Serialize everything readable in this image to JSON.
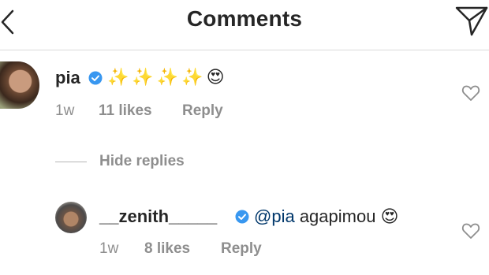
{
  "header": {
    "title": "Comments",
    "back_icon": "chevron-left-icon",
    "send_icon": "paper-plane-icon"
  },
  "comment": {
    "username": "pia",
    "text": "✨✨✨✨😍",
    "time": "1w",
    "likes": "11 likes",
    "reply": "Reply"
  },
  "hide_replies": "Hide replies",
  "reply": {
    "username": "__zenith_____",
    "mention": "@pia",
    "text": " agapimou 😍",
    "time": "1w",
    "likes": "8 likes",
    "reply": "Reply"
  },
  "colors": {
    "verified_blue": "#3897f0",
    "mention": "#00376b",
    "meta_gray": "#8e8e8e"
  }
}
